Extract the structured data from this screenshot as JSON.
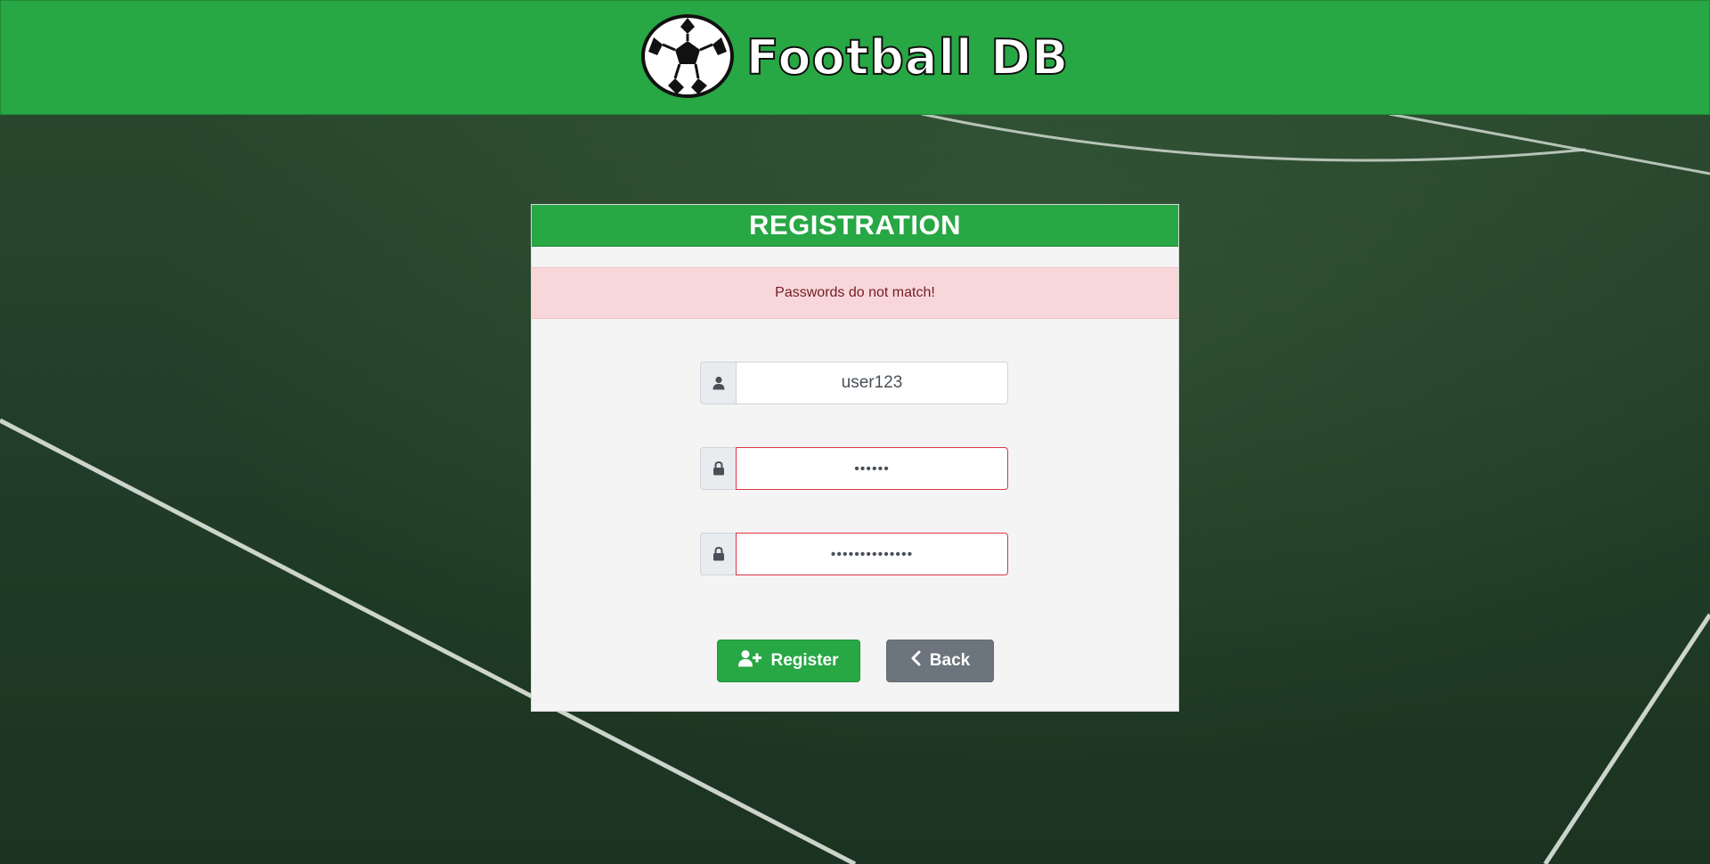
{
  "header": {
    "brand_name": "Football DB",
    "logo_icon": "soccer-ball-icon"
  },
  "card": {
    "title": "REGISTRATION",
    "alert": {
      "message": "Passwords do not match!",
      "color": "#f8d7da"
    },
    "fields": {
      "username": {
        "value": "user123",
        "icon": "user-icon"
      },
      "password": {
        "value": "••••••",
        "icon": "lock-icon",
        "invalid": true
      },
      "confirm_password": {
        "value": "••••••••••••••",
        "icon": "lock-icon",
        "invalid": true
      }
    },
    "buttons": {
      "register_label": "Register",
      "register_icon": "user-plus-icon",
      "back_label": "Back",
      "back_icon": "chevron-left-icon"
    }
  },
  "colors": {
    "accent": "#28a745",
    "secondary": "#6c757d",
    "danger": "#dc3545"
  }
}
